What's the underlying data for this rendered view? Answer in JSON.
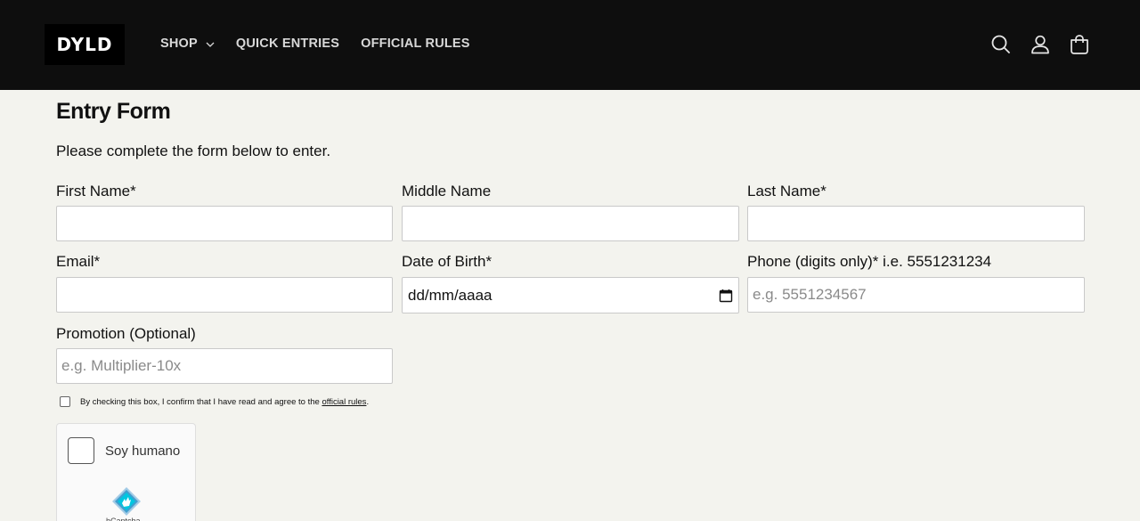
{
  "header": {
    "logo_text": "DYLD",
    "nav": [
      {
        "label": "SHOP",
        "has_dropdown": true
      },
      {
        "label": "QUICK ENTRIES"
      },
      {
        "label": "OFFICIAL RULES"
      }
    ],
    "icons": [
      "search-icon",
      "account-icon",
      "cart-icon"
    ]
  },
  "form": {
    "title": "Entry Form",
    "intro": "Please complete the form below to enter.",
    "first_name": {
      "label": "First Name*",
      "value": "",
      "placeholder": ""
    },
    "middle_name": {
      "label": "Middle Name",
      "value": "",
      "placeholder": ""
    },
    "last_name": {
      "label": "Last Name*",
      "value": "",
      "placeholder": ""
    },
    "email": {
      "label": "Email*",
      "value": "",
      "placeholder": ""
    },
    "dob": {
      "label": "Date of Birth*",
      "value": "dd/mm/aaaa"
    },
    "phone": {
      "label": "Phone (digits only)* i.e. 5551231234",
      "value": "",
      "placeholder": "e.g. 5551234567"
    },
    "promotion": {
      "label": "Promotion (Optional)",
      "value": "",
      "placeholder": "e.g. Multiplier-10x"
    },
    "agree": {
      "text_before": "By checking this box, I confirm that I have read and agree to the ",
      "link": "official rules",
      "text_after": ".",
      "checked": false
    }
  },
  "captcha": {
    "label": "Soy humano",
    "brand": "hCaptcha",
    "checked": false
  },
  "colors": {
    "header_bg": "#0e0e0e",
    "page_bg": "#f3f3ee",
    "nav_text": "#d8d8d8"
  }
}
